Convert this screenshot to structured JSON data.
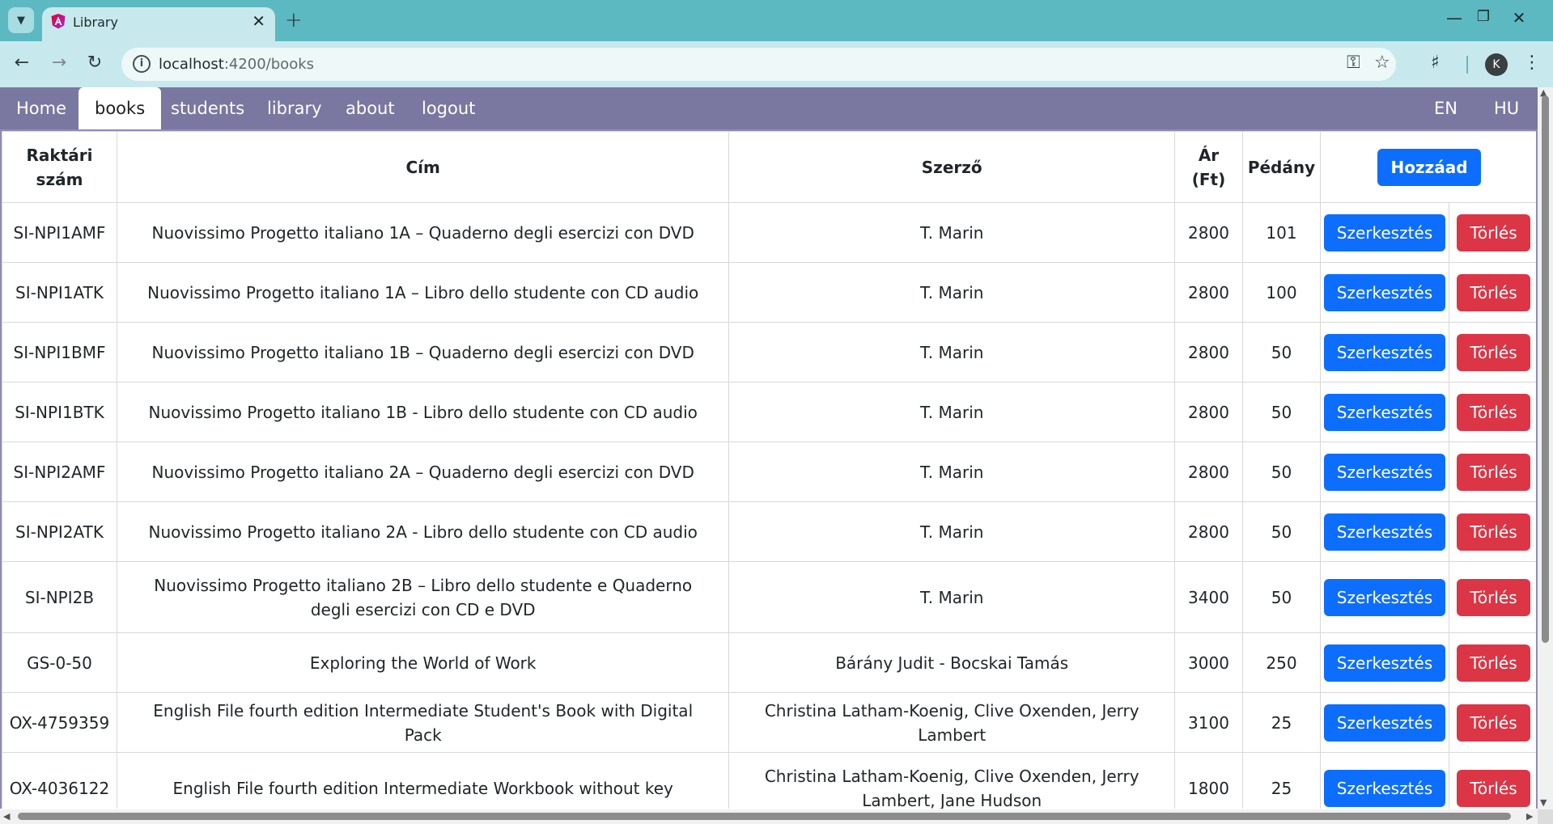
{
  "browser": {
    "tab_title": "Library",
    "url_host": "localhost",
    "url_rest": ":4200/books",
    "tab_search_icon": "chevron-down-icon",
    "new_tab_icon": "plus-icon",
    "close_tab_icon": "close-icon"
  },
  "nav": {
    "items": [
      "Home",
      "books",
      "students",
      "library",
      "about",
      "logout"
    ],
    "active": "books",
    "lang": [
      "EN",
      "HU"
    ]
  },
  "table": {
    "headers": {
      "stock_no": "Raktári szám",
      "title": "Cím",
      "author": "Szerző",
      "price": "Ár (Ft)",
      "copies": "Pédány",
      "add_button": "Hozzáad"
    },
    "edit_label": "Szerkesztés",
    "delete_label": "Törlés",
    "rows": [
      {
        "id": "SI-NPI1AMF",
        "title": "Nuovissimo Progetto italiano 1A – Quaderno degli esercizi con DVD",
        "author": "T. Marin",
        "price": "2800",
        "copies": "101"
      },
      {
        "id": "SI-NPI1ATK",
        "title": "Nuovissimo Progetto italiano 1A – Libro dello studente con CD audio",
        "author": "T. Marin",
        "price": "2800",
        "copies": "100"
      },
      {
        "id": "SI-NPI1BMF",
        "title": "Nuovissimo Progetto italiano 1B – Quaderno degli esercizi con DVD",
        "author": "T. Marin",
        "price": "2800",
        "copies": "50"
      },
      {
        "id": "SI-NPI1BTK",
        "title": "Nuovissimo Progetto italiano 1B - Libro dello studente con CD audio",
        "author": "T. Marin",
        "price": "2800",
        "copies": "50"
      },
      {
        "id": "SI-NPI2AMF",
        "title": "Nuovissimo Progetto italiano 2A – Quaderno degli esercizi con DVD",
        "author": "T. Marin",
        "price": "2800",
        "copies": "50"
      },
      {
        "id": "SI-NPI2ATK",
        "title": "Nuovissimo Progetto italiano 2A - Libro dello studente con CD audio",
        "author": "T. Marin",
        "price": "2800",
        "copies": "50"
      },
      {
        "id": "SI-NPI2B",
        "title": "Nuovissimo Progetto italiano 2B – Libro dello studente e Quaderno degli esercizi con CD e DVD",
        "author": "T. Marin",
        "price": "3400",
        "copies": "50"
      },
      {
        "id": "GS-0-50",
        "title": "Exploring the World of Work",
        "author": "Bárány Judit - Bocskai Tamás",
        "price": "3000",
        "copies": "250"
      },
      {
        "id": "OX-4759359",
        "title": "English File fourth edition Intermediate Student's Book with Digital Pack",
        "author": "Christina Latham-Koenig, Clive Oxenden, Jerry Lambert",
        "price": "3100",
        "copies": "25"
      },
      {
        "id": "OX-4036122",
        "title": "English File fourth edition Intermediate Workbook without key",
        "author": "Christina Latham-Koenig, Clive Oxenden, Jerry Lambert, Jane Hudson",
        "price": "1800",
        "copies": "25"
      }
    ]
  }
}
